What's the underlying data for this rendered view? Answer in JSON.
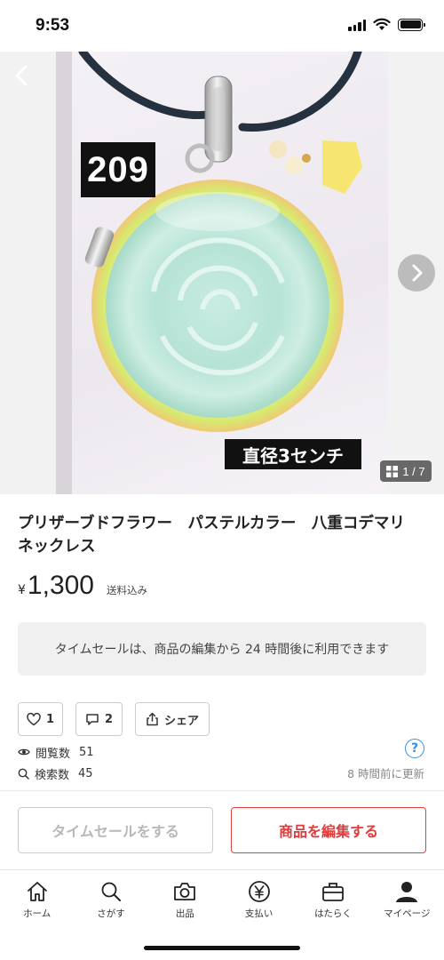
{
  "status": {
    "time": "9:53"
  },
  "gallery": {
    "counter": "1 / 7",
    "image_number_label": "209",
    "diameter_label": "直径3センチ"
  },
  "item": {
    "title": "プリザーブドフラワー　パステルカラー　八重コデマリ　ネックレス",
    "currency": "¥",
    "price": "1,300",
    "shipping": "送料込み"
  },
  "notice": "タイムセールは、商品の編集から 24 時間後に利用できます",
  "actions": {
    "like_count": "1",
    "comment_count": "2",
    "share_label": "シェア"
  },
  "stats": {
    "views_label": "閲覧数",
    "views": "51",
    "searches_label": "検索数",
    "searches": "45",
    "updated": "8 時間前に更新"
  },
  "buttons": {
    "timesale": "タイムセールをする",
    "edit": "商品を編集する"
  },
  "tabbar": [
    {
      "label": "ホーム",
      "icon": "home-icon"
    },
    {
      "label": "さがす",
      "icon": "search-icon"
    },
    {
      "label": "出品",
      "icon": "camera-icon"
    },
    {
      "label": "支払い",
      "icon": "yen-icon"
    },
    {
      "label": "はたらく",
      "icon": "briefcase-icon"
    },
    {
      "label": "マイページ",
      "icon": "person-icon"
    }
  ],
  "colors": {
    "accent_red": "#e03a3a",
    "help_blue": "#3a8ee6"
  }
}
